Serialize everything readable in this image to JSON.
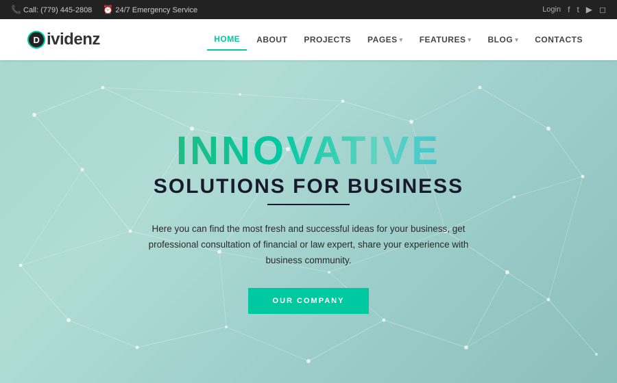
{
  "topbar": {
    "phone": "Call: (779) 445-2808",
    "emergency": "24/7 Emergency Service",
    "login": "Login"
  },
  "logo": {
    "letter": "D",
    "text": "ividenz"
  },
  "nav": {
    "items": [
      {
        "label": "HOME",
        "active": true,
        "hasDropdown": false
      },
      {
        "label": "ABOUT",
        "active": false,
        "hasDropdown": false
      },
      {
        "label": "PROJECTS",
        "active": false,
        "hasDropdown": false
      },
      {
        "label": "PAGES",
        "active": false,
        "hasDropdown": true
      },
      {
        "label": "FEATURES",
        "active": false,
        "hasDropdown": true
      },
      {
        "label": "BLOG",
        "active": false,
        "hasDropdown": true
      },
      {
        "label": "CONTACTS",
        "active": false,
        "hasDropdown": false
      }
    ]
  },
  "hero": {
    "title_top": "INNOVATIVE",
    "title_bottom": "SOLUTIONS FOR BUSINESS",
    "description": "Here you can find the most fresh and successful ideas for your business, get professional consultation of financial or law expert, share your experience with business community.",
    "button_label": "OUR COMPANY"
  },
  "social": {
    "icons": [
      "f",
      "t",
      "▶",
      "☰"
    ]
  }
}
